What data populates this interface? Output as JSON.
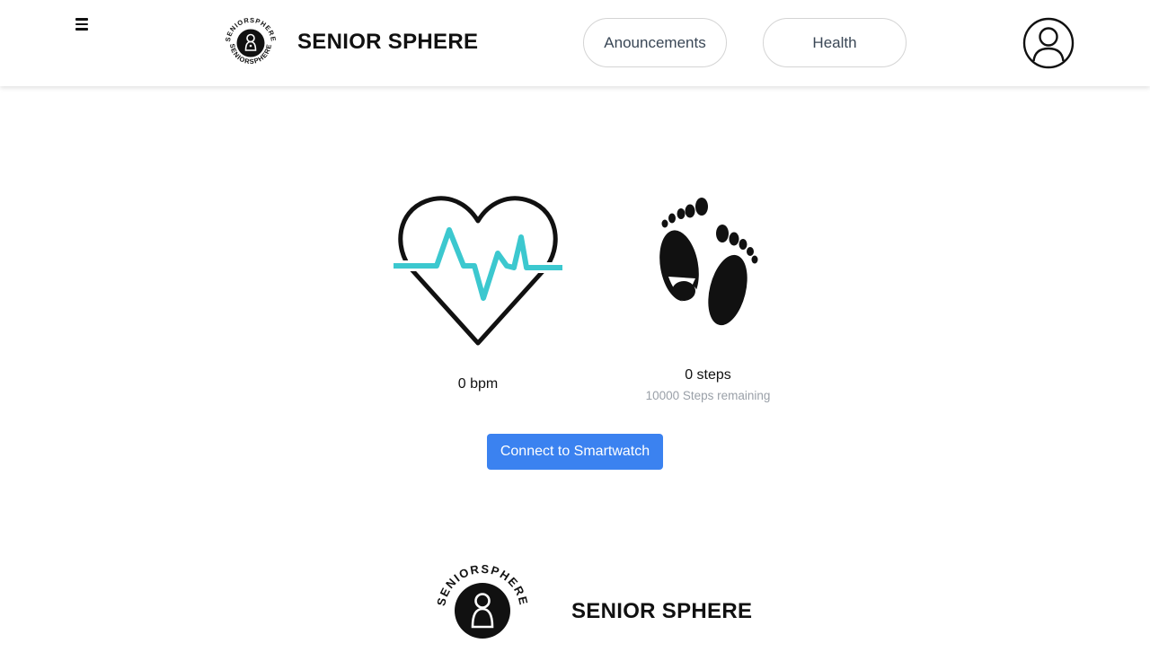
{
  "header": {
    "menu_icon": "hamburger-menu-icon",
    "logo_seal_text": "SENIORSPHERE",
    "brand_title": "SENIOR SPHERE",
    "nav": [
      {
        "label": "Anouncements"
      },
      {
        "label": "Health"
      }
    ],
    "avatar_icon": "user-avatar-icon"
  },
  "stats": {
    "heart_rate": "0 bpm",
    "steps": "0 steps",
    "steps_remaining": "10000 Steps remaining",
    "heart_icon": "heart-pulse-icon",
    "feet_icon": "footprints-icon"
  },
  "actions": {
    "connect_label": "Connect to Smartwatch"
  },
  "footer": {
    "logo_seal_text": "SENIORSPHERE",
    "brand_title": "SENIOR SPHERE"
  },
  "colors": {
    "accent_blue": "#3b82f0",
    "pulse_teal": "#3cc8cf",
    "text_dark": "#111111",
    "text_muted": "#9aa0a8"
  }
}
